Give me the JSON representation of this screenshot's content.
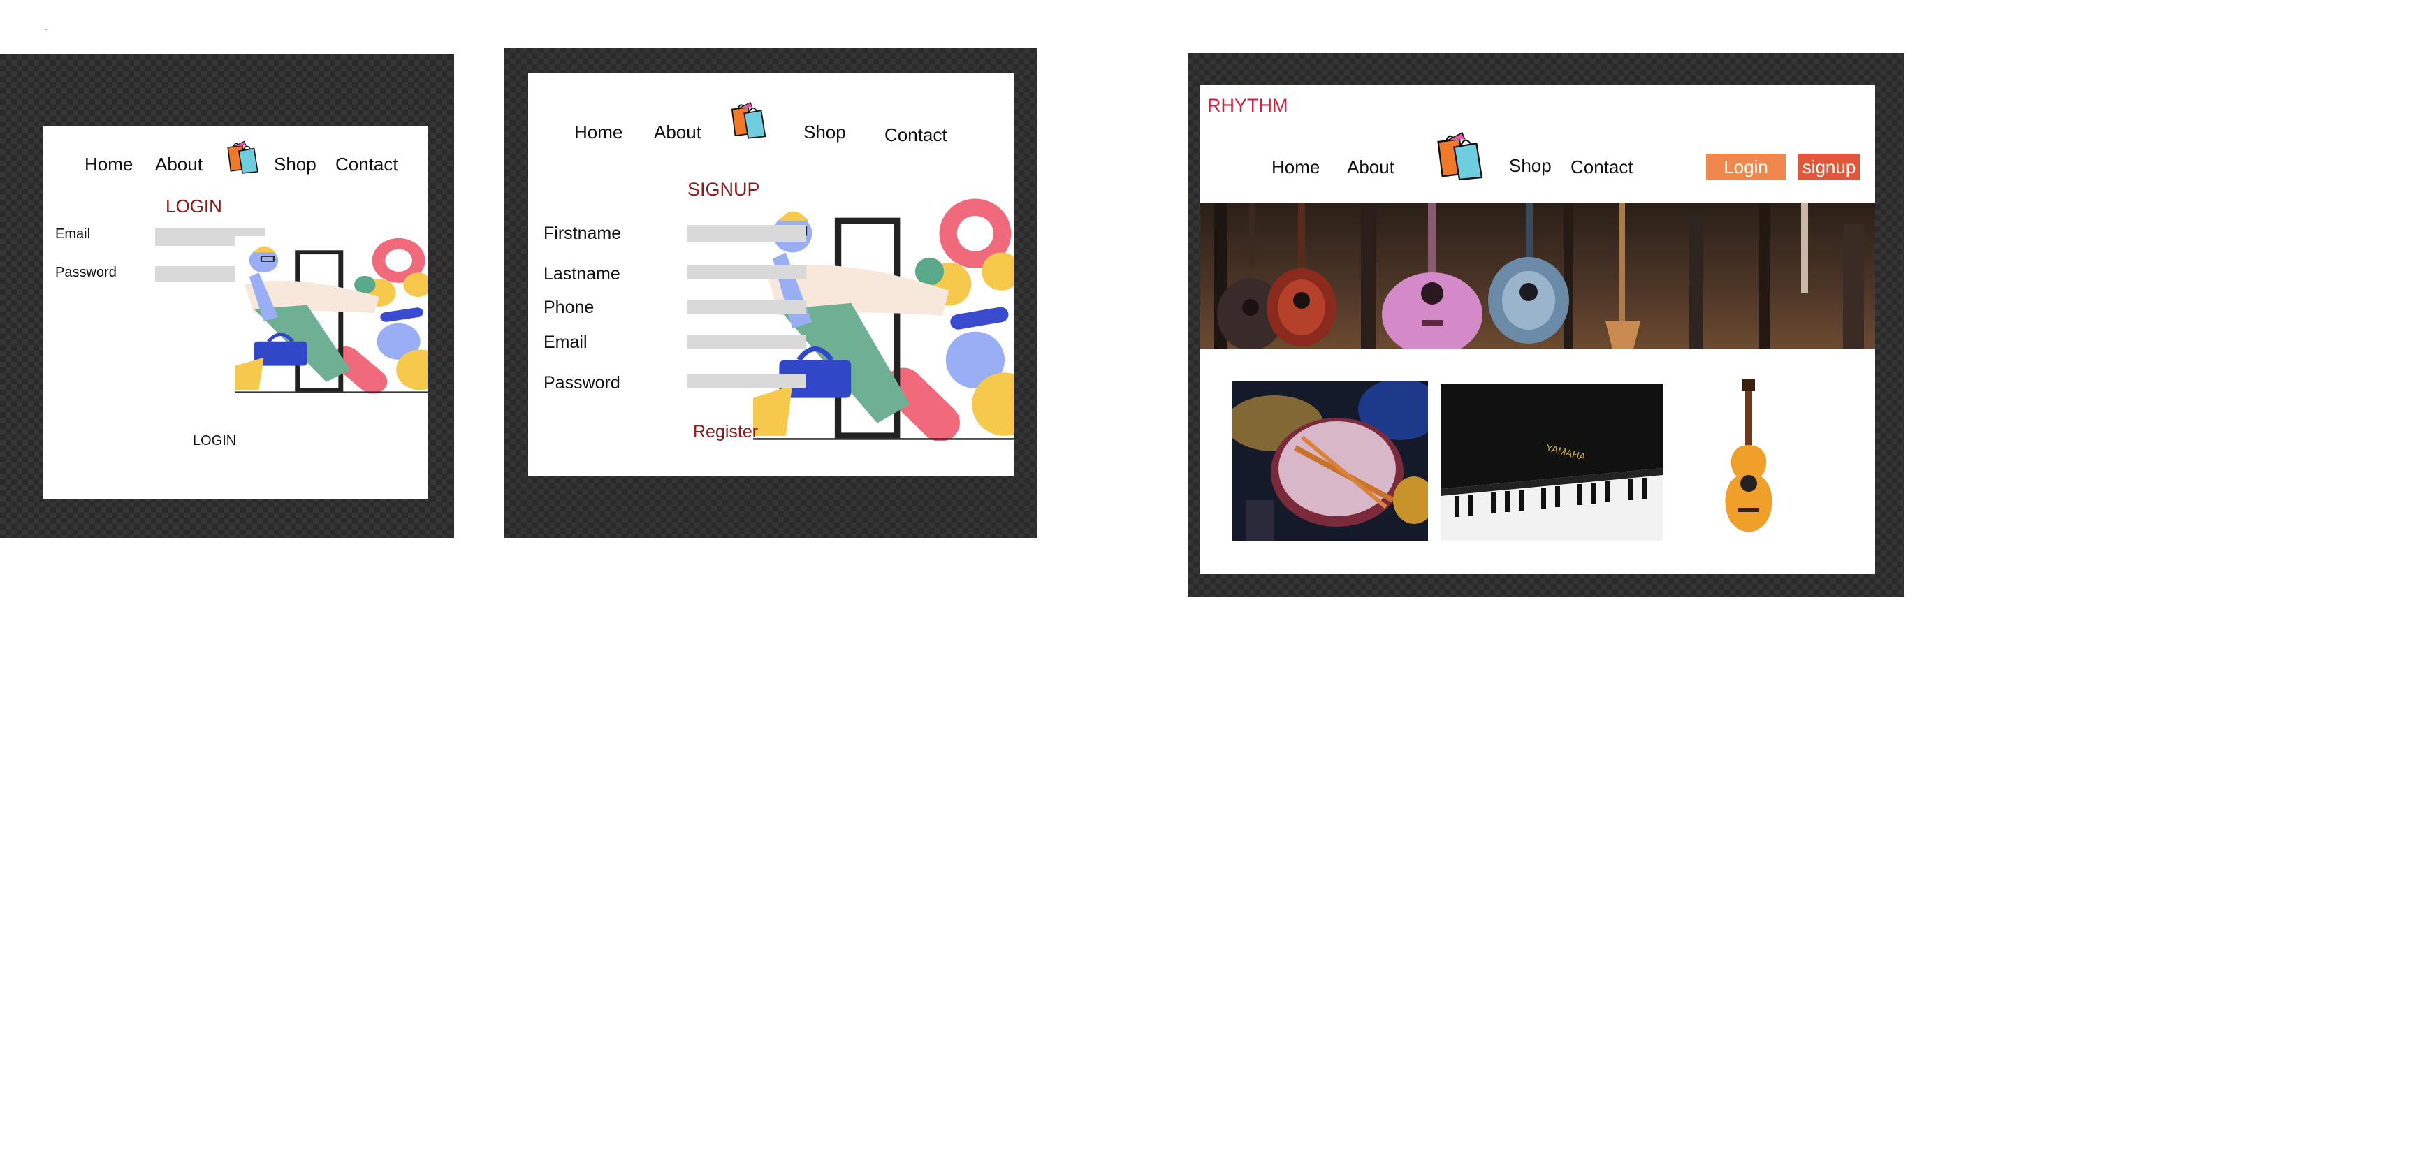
{
  "stray_mark": "-",
  "login_screen": {
    "nav": {
      "home": "Home",
      "about": "About",
      "shop": "Shop",
      "contact": "Contact"
    },
    "title": "LOGIN",
    "fields": {
      "email_label": "Email",
      "password_label": "Password"
    },
    "submit_label": "LOGIN"
  },
  "signup_screen": {
    "nav": {
      "home": "Home",
      "about": "About",
      "shop": "Shop",
      "contact": "Contact"
    },
    "title": "SIGNUP",
    "fields": {
      "firstname_label": "Firstname",
      "lastname_label": "Lastname",
      "phone_label": "Phone",
      "email_label": "Email",
      "password_label": "Password"
    },
    "submit_label": "Register"
  },
  "home_screen": {
    "brand": "RHYTHM",
    "nav": {
      "home": "Home",
      "about": "About",
      "shop": "Shop",
      "contact": "Contact"
    },
    "login_button": "Login",
    "signup_button": "signup",
    "banner_icon": "ukulele-wall-photo",
    "products": [
      "drum-photo",
      "piano-photo",
      "acoustic-guitar-photo"
    ]
  },
  "colors": {
    "frame": "#2a2a2a",
    "maroon_text": "#8b1a1a",
    "brand_red": "#d0213a",
    "login_button": "#f0874c",
    "signup_button": "#e2573a",
    "field_gray": "#d9d9d9"
  }
}
